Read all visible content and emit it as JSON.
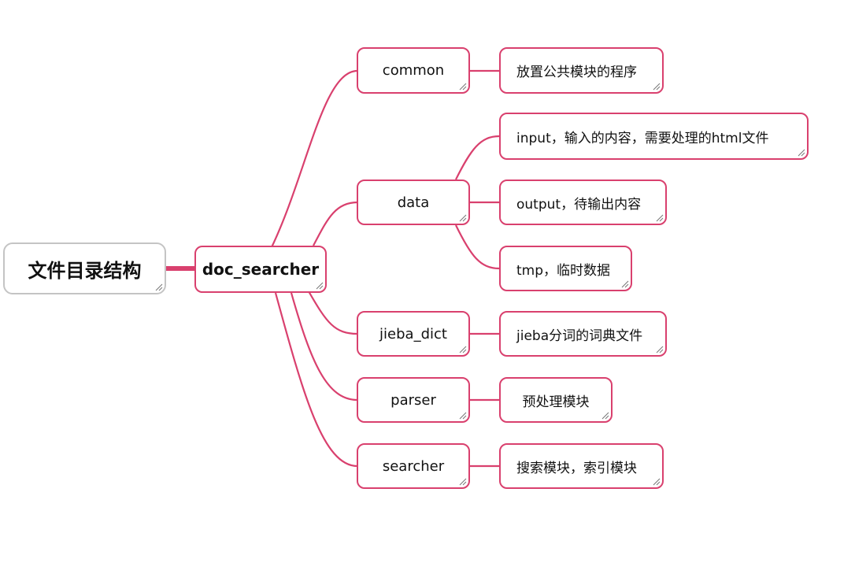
{
  "root": {
    "label": "文件目录结构"
  },
  "center": {
    "label": "doc_searcher"
  },
  "branches": [
    {
      "label": "common",
      "children": [
        "放置公共模块的程序"
      ]
    },
    {
      "label": "data",
      "children": [
        "input，输入的内容，需要处理的html文件",
        "output，待输出内容",
        "tmp，临时数据"
      ]
    },
    {
      "label": "jieba_dict",
      "children": [
        "jieba分词的词典文件"
      ]
    },
    {
      "label": "parser",
      "children": [
        "预处理模块"
      ]
    },
    {
      "label": "searcher",
      "children": [
        "搜索模块，索引模块"
      ]
    }
  ],
  "colors": {
    "accent": "#d9406e",
    "root_border": "#c4c4c4"
  },
  "icons": {
    "resize": "resize-grip-icon"
  }
}
